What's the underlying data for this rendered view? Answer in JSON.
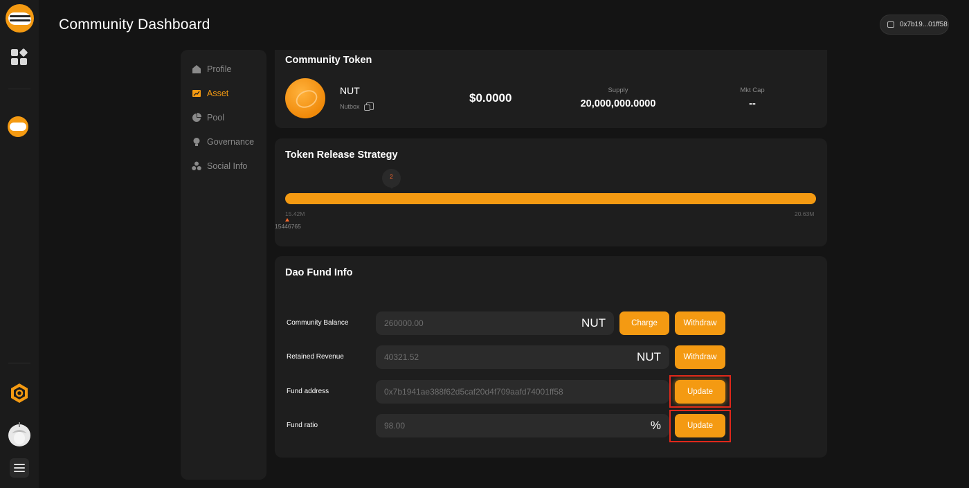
{
  "header": {
    "title": "Community Dashboard",
    "wallet": "0x7b19...01ff58"
  },
  "rail": {
    "icons": [
      "nutbox-logo-icon",
      "apps-grid-icon",
      "community-avatar-icon",
      "hexagon-icon",
      "acorn-avatar-icon",
      "menu-list-icon"
    ]
  },
  "sidenav": {
    "items": [
      {
        "label": "Profile",
        "icon": "home-icon",
        "active": false
      },
      {
        "label": "Asset",
        "icon": "chart-icon",
        "active": true
      },
      {
        "label": "Pool",
        "icon": "pie-icon",
        "active": false
      },
      {
        "label": "Governance",
        "icon": "bulb-icon",
        "active": false
      },
      {
        "label": "Social Info",
        "icon": "share-icon",
        "active": false
      }
    ]
  },
  "token": {
    "title": "Community Token",
    "symbol": "NUT",
    "name": "Nutbox",
    "price": "$0.0000",
    "supply_label": "Supply",
    "supply": "20,000,000.0000",
    "mktcap_label": "Mkt Cap",
    "mktcap": "--"
  },
  "release": {
    "title": "Token Release Strategy",
    "bubble": "2",
    "min": "15.42M",
    "max": "20.63M",
    "current": "15446765",
    "progress": 1.0
  },
  "dao": {
    "title": "Dao Fund Info",
    "rows": {
      "balance": {
        "label": "Community Balance",
        "value": "260000.00",
        "unit": "NUT",
        "charge": "Charge",
        "withdraw": "Withdraw"
      },
      "revenue": {
        "label": "Retained Revenue",
        "value": "40321.52",
        "unit": "NUT",
        "withdraw": "Withdraw"
      },
      "address": {
        "label": "Fund address",
        "value": "0x7b1941ae388f62d5caf20d4f709aafd74001ff58",
        "update": "Update"
      },
      "ratio": {
        "label": "Fund ratio",
        "value": "98.00",
        "unit": "%",
        "update": "Update"
      }
    }
  },
  "colors": {
    "accent": "#f49a12",
    "highlight": "#e0281b",
    "bg": "#141414",
    "card": "#1e1e1e"
  }
}
